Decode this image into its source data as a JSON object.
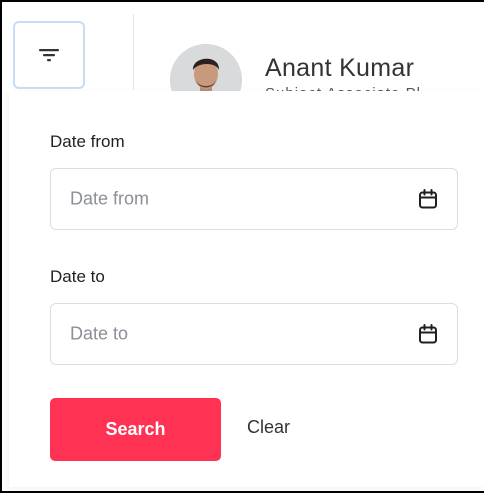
{
  "header": {
    "user_name": "Anant Kumar",
    "user_subtitle": "Subject Associate Pl"
  },
  "filter_panel": {
    "date_from": {
      "label": "Date from",
      "placeholder": "Date from",
      "value": ""
    },
    "date_to": {
      "label": "Date to",
      "placeholder": "Date to",
      "value": ""
    },
    "search_label": "Search",
    "clear_label": "Clear"
  },
  "icons": {
    "filter": "filter-icon",
    "calendar": "calendar-icon",
    "avatar": "user-avatar"
  },
  "colors": {
    "accent": "#ff3254",
    "filter_button_border": "#c8dcf6",
    "input_border": "#dadde2",
    "placeholder_text": "#8b8f97"
  }
}
